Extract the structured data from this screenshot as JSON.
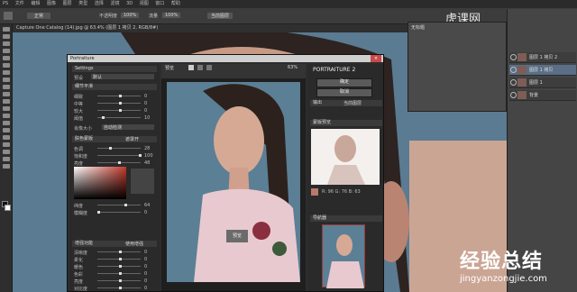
{
  "menubar": {
    "items": [
      "PS",
      "文件",
      "编辑",
      "图像",
      "图层",
      "类型",
      "选择",
      "滤镜",
      "3D",
      "视图",
      "窗口",
      "帮助"
    ]
  },
  "optbar": {
    "mode_label": "正常",
    "opacity_label": "不透明度",
    "opacity_value": "100%",
    "flow_label": "流量",
    "flow_value": "100%",
    "sample_label": "当前图层"
  },
  "doc_tab": {
    "title": "Capture One Catalog (14).jpg @ 63.4% (图层 1 拷贝 2, RGB/8#)"
  },
  "watermark_top": {
    "brand": "虎课网"
  },
  "float_panel": {
    "title": "无标题"
  },
  "layers": [
    {
      "name": "图层 1 拷贝 2"
    },
    {
      "name": "图层 1 拷贝"
    },
    {
      "name": "图层 1"
    },
    {
      "name": "背景"
    }
  ],
  "portraiture": {
    "title": "Portraiture",
    "close_label": "×",
    "settings_label": "Settings",
    "preset_label": "预设",
    "preset_value": "默认",
    "detail_section": "细节平滑",
    "detail_sliders": [
      {
        "label": "细致",
        "value": "0"
      },
      {
        "label": "中等",
        "value": "0"
      },
      {
        "label": "较大",
        "value": "0"
      },
      {
        "label": "阈值",
        "value": "10"
      }
    ],
    "size_label": "肖像大小",
    "size_value": "自动检测",
    "mask_section": "肤色蒙版",
    "mask_toggle": "遮罩开",
    "mask_sliders": [
      {
        "label": "色调",
        "value": "28"
      },
      {
        "label": "饱和度",
        "value": "100"
      },
      {
        "label": "亮度",
        "value": "48"
      },
      {
        "label": "纬度",
        "value": "64"
      },
      {
        "label": "模糊度",
        "value": "0"
      }
    ],
    "enhance_section": "增强功能",
    "enhance_toggle": "使用增强",
    "enhance_sliders": [
      {
        "label": "清晰度",
        "value": "0"
      },
      {
        "label": "柔化",
        "value": "0"
      },
      {
        "label": "暖色",
        "value": "0"
      },
      {
        "label": "色彩",
        "value": "0"
      },
      {
        "label": "亮度",
        "value": "0"
      },
      {
        "label": "对比度",
        "value": "0"
      }
    ],
    "view_label": "预览",
    "zoom_value": "63%",
    "photo_tag": "预览",
    "brand": "PORTRAITURE 2",
    "ok_label": "确定",
    "cancel_label": "取消",
    "output_label": "输出",
    "output_value": "当前图层",
    "mask_preview_section": "蒙版预览",
    "nav_section": "导航器",
    "mask_info": "R: 96  G: 76  B: 63"
  },
  "watermark": {
    "cn": "经验总结",
    "url": "jingyanzongjie.com"
  }
}
